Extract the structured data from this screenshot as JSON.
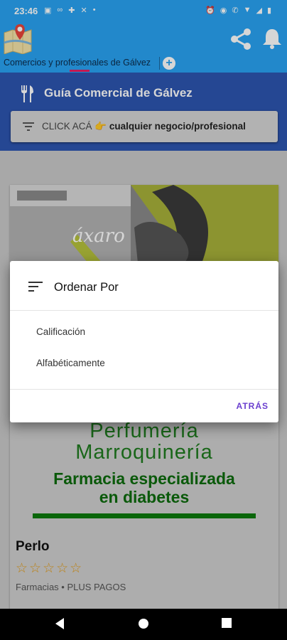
{
  "status_bar": {
    "time": "23:46",
    "left_icons": [
      "image-icon",
      "voicemail-icon",
      "puzzle-icon",
      "tools-icon",
      "dot-icon"
    ],
    "right_icons": [
      "alarm-icon",
      "eye-icon",
      "wifi-call-icon",
      "wifi-icon",
      "signal-icon",
      "battery-icon"
    ]
  },
  "app_bar": {
    "tab_label": "Comercios y profesionales de Gálvez",
    "add_tab_symbol": "+",
    "accent_color": "#29a3f2",
    "indicator_color": "#e91e63"
  },
  "header": {
    "title": "Guía Comercial de Gálvez",
    "search_prefix": "CLICK ACÁ 👉",
    "search_bold": " cualquier negocio/profesional",
    "color": "#2d55b0"
  },
  "card": {
    "image_brand": "áxaro",
    "promo_line1": "Perfumería",
    "promo_line2": "Marroquinería",
    "promo_line3": "Farmacia especializada",
    "promo_line4": "en diabetes",
    "name": "Perlo",
    "stars": "☆☆☆☆☆",
    "rating": 0,
    "meta": "Farmacias • PLUS PAGOS"
  },
  "dialog": {
    "title": "Ordenar Por",
    "options": [
      "Calificación",
      "Alfabéticamente"
    ],
    "back_label": "ATRÁS",
    "back_color": "#6a3fcf"
  }
}
